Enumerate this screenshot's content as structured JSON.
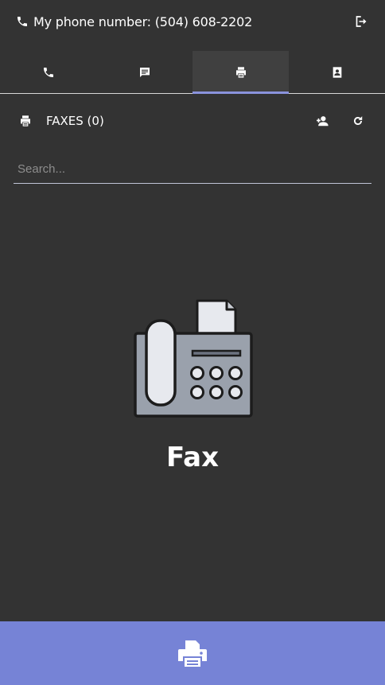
{
  "header": {
    "phone_label": "My phone number: (504) 608-2202",
    "icons": {
      "phone": "phone-icon",
      "logout": "logout-icon"
    }
  },
  "tabs": [
    {
      "id": "calls",
      "icon": "phone-icon",
      "active": false
    },
    {
      "id": "messages",
      "icon": "message-icon",
      "active": false
    },
    {
      "id": "faxes",
      "icon": "printer-icon",
      "active": true
    },
    {
      "id": "contacts",
      "icon": "contact-card-icon",
      "active": false
    }
  ],
  "section": {
    "title": "FAXES (0)",
    "icons": {
      "leading": "printer-icon",
      "add": "add-contact-icon",
      "refresh": "refresh-icon"
    }
  },
  "search": {
    "placeholder": "Search...",
    "value": ""
  },
  "empty_state": {
    "title": "Fax",
    "illustration": "fax-machine-icon"
  },
  "bottom_action": {
    "icon": "printer-icon"
  },
  "colors": {
    "background": "#333333",
    "active_tab": "#404040",
    "accent": "#7683d6",
    "indicator": "#8a93dc"
  }
}
